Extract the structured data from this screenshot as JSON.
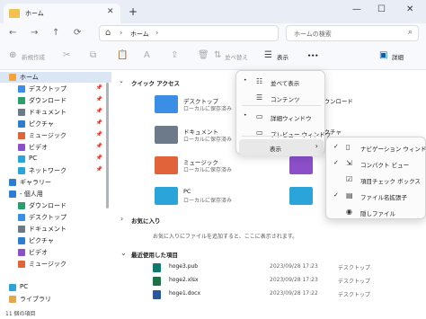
{
  "tab": {
    "title": "ホーム"
  },
  "address": {
    "location": "ホーム"
  },
  "search": {
    "placeholder": "ホームの検索"
  },
  "toolbar": {
    "new_label": "新規作成",
    "sort_label": "並べ替え",
    "view_label": "表示",
    "more_label": "•••",
    "details_label": "詳細"
  },
  "sidebar": {
    "items": [
      {
        "label": "ホーム",
        "icon": "home-icon",
        "pinned": false,
        "color": "#f2a33c"
      },
      {
        "label": "デスクトップ",
        "icon": "desktop-icon",
        "pinned": true,
        "color": "#3a8ee6"
      },
      {
        "label": "ダウンロード",
        "icon": "download-icon",
        "pinned": true,
        "color": "#2b9f6b"
      },
      {
        "label": "ドキュメント",
        "icon": "document-icon",
        "pinned": true,
        "color": "#6c7a89"
      },
      {
        "label": "ピクチャ",
        "icon": "picture-icon",
        "pinned": true,
        "color": "#2d7dd2"
      },
      {
        "label": "ミュージック",
        "icon": "music-icon",
        "pinned": true,
        "color": "#e0633a"
      },
      {
        "label": "ビデオ",
        "icon": "video-icon",
        "pinned": true,
        "color": "#8c4fc9"
      },
      {
        "label": "PC",
        "icon": "pc-icon",
        "pinned": true,
        "color": "#2aa4d9"
      },
      {
        "label": "ネットワーク",
        "icon": "network-icon",
        "pinned": true,
        "color": "#2aa4d9"
      },
      {
        "label": "ギャラリー",
        "icon": "gallery-icon",
        "pinned": false,
        "color": "#2d7dd2"
      },
      {
        "label": "- 個人用",
        "icon": "onedrive-icon",
        "pinned": false,
        "color": "#2d7dd2"
      },
      {
        "label": "ダウンロード",
        "icon": "download-icon",
        "pinned": false,
        "color": "#2b9f6b"
      },
      {
        "label": "デスクトップ",
        "icon": "desktop-icon",
        "pinned": false,
        "color": "#3a8ee6"
      },
      {
        "label": "ドキュメント",
        "icon": "document-icon",
        "pinned": false,
        "color": "#6c7a89"
      },
      {
        "label": "ピクチャ",
        "icon": "picture-icon",
        "pinned": false,
        "color": "#2d7dd2"
      },
      {
        "label": "ビデオ",
        "icon": "video-icon",
        "pinned": false,
        "color": "#8c4fc9"
      },
      {
        "label": "ミュージック",
        "icon": "music-icon",
        "pinned": false,
        "color": "#e0633a"
      },
      {
        "label": "",
        "icon": "blank-icon",
        "pinned": false,
        "color": "#ffffff"
      },
      {
        "label": "PC",
        "icon": "pc-icon",
        "pinned": false,
        "color": "#2aa4d9"
      },
      {
        "label": "ライブラリ",
        "icon": "library-icon",
        "pinned": false,
        "color": "#e4a84a"
      }
    ]
  },
  "main": {
    "quick_access_title": "クイック アクセス",
    "quick_access": [
      {
        "name": "デスクトップ",
        "sub": "ローカルに保存済み",
        "color": "#3a8ee6"
      },
      {
        "name": "ダウンロード",
        "sub": "",
        "color": "#2b9f6b"
      },
      {
        "name": "ドキュメント",
        "sub": "ローカルに保存済み",
        "color": "#6c7a89"
      },
      {
        "name": "ピクチャ",
        "sub": "",
        "color": "#2d7dd2"
      },
      {
        "name": "ミュージック",
        "sub": "ローカルに保存済み",
        "color": "#e0633a"
      },
      {
        "name": "",
        "sub": "",
        "color": "#8c4fc9"
      },
      {
        "name": "PC",
        "sub": "ローカルに保存済み",
        "color": "#2aa4d9"
      },
      {
        "name": "",
        "sub": "",
        "color": "#2aa4d9"
      }
    ],
    "favorites_title": "お気に入り",
    "favorites_empty": "お気に入りにファイルを追加すると、ここに表示されます。",
    "recent_title": "最近使用した項目",
    "recent": [
      {
        "name": "hoge3.pub",
        "date": "2023/09/28 17:23",
        "location": "デスクトップ",
        "color": "#0f7a6c"
      },
      {
        "name": "hoge2.xlsx",
        "date": "2023/09/28 17:23",
        "location": "デスクトップ",
        "color": "#1e7145"
      },
      {
        "name": "hoge1.docx",
        "date": "2023/09/28 17:22",
        "location": "デスクトップ",
        "color": "#2b579a"
      }
    ]
  },
  "view_menu": {
    "items": [
      {
        "label": "並べて表示",
        "icon": "tiles-icon",
        "mark": "•"
      },
      {
        "label": "コンテンツ",
        "icon": "content-icon",
        "mark": ""
      },
      {
        "label": "詳細ウィンドウ",
        "icon": "details-pane-icon",
        "mark": "•"
      },
      {
        "label": "プレビュー ウィンドウ",
        "icon": "preview-pane-icon",
        "mark": ""
      },
      {
        "label": "表示",
        "icon": "",
        "mark": ""
      }
    ]
  },
  "show_submenu": {
    "items": [
      {
        "label": "ナビゲーション ウィンドウ",
        "icon": "nav-pane-icon",
        "checked": true
      },
      {
        "label": "コンパクト ビュー",
        "icon": "compact-icon",
        "checked": true
      },
      {
        "label": "項目チェック ボックス",
        "icon": "checkbox-icon",
        "checked": false
      },
      {
        "label": "ファイル名拡張子",
        "icon": "extension-icon",
        "checked": true
      },
      {
        "label": "隠しファイル",
        "icon": "hidden-icon",
        "checked": false
      }
    ]
  },
  "status": {
    "text": "11 個の項目"
  },
  "colors": {
    "accent": "#005fb8",
    "chrome": "#e9eef6",
    "selection": "#dbe6f4"
  }
}
